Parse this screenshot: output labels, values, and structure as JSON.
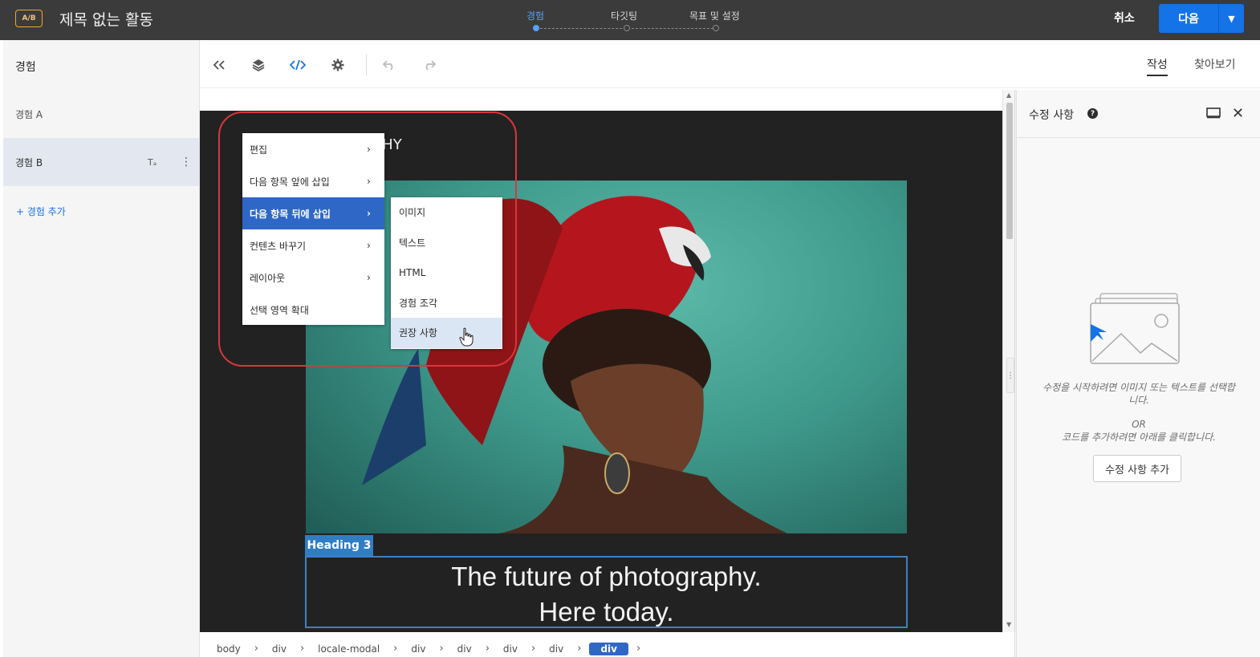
{
  "header": {
    "badge": "A/B",
    "title": "제목 없는 활동",
    "steps": [
      {
        "label": "경험",
        "active": true
      },
      {
        "label": "타깃팅",
        "active": false
      },
      {
        "label": "목표 및 설정",
        "active": false
      }
    ],
    "cancel_label": "취소",
    "next_label": "다음",
    "next_dropdown_icon": "chevron-down-icon"
  },
  "sidebar": {
    "heading": "경험",
    "items": [
      {
        "label": "경험 A",
        "selected": false
      },
      {
        "label": "경험 B",
        "selected": true
      }
    ],
    "rename_icon": "text-rename-icon",
    "more_icon": "more-vertical-icon",
    "add_label": "+ 경험 추가"
  },
  "toolbar": {
    "icons": [
      "collapse-left-icon",
      "layers-icon",
      "code-icon",
      "settings-icon",
      "undo-icon",
      "redo-icon"
    ],
    "tabs": [
      {
        "label": "작성",
        "active": true
      },
      {
        "label": "찾아보기",
        "active": false
      }
    ]
  },
  "canvas": {
    "partial_title": "APHY",
    "heading_tag": "Heading 3",
    "heading_line1": "The future of photography.",
    "heading_line2": "Here today."
  },
  "context_menu": {
    "items": [
      {
        "label": "편집",
        "has_submenu": true,
        "highlighted": false
      },
      {
        "label": "다음 항목 앞에 삽입",
        "has_submenu": true,
        "highlighted": false
      },
      {
        "label": "다음 항목 뒤에 삽입",
        "has_submenu": true,
        "highlighted": true
      },
      {
        "label": "컨텐츠 바꾸기",
        "has_submenu": true,
        "highlighted": false
      },
      {
        "label": "레이아웃",
        "has_submenu": true,
        "highlighted": false
      },
      {
        "label": "선택 영역 확대",
        "has_submenu": false,
        "highlighted": false
      }
    ],
    "submenu": [
      {
        "label": "이미지"
      },
      {
        "label": "텍스트"
      },
      {
        "label": "HTML"
      },
      {
        "label": "경험 조각"
      },
      {
        "label": "권장 사항",
        "hover": true
      }
    ]
  },
  "breadcrumb": [
    "body",
    "div",
    "locale-modal",
    "div",
    "div",
    "div",
    "div",
    "div"
  ],
  "panel": {
    "title": "수정 사항",
    "empty_text_1": "수정을 시작하려면 이미지 또는 텍스트를 선택합니다.",
    "empty_or": "OR",
    "empty_text_2": "코드를 추가하려면 아래를 클릭합니다.",
    "add_button": "수정 사항 추가"
  },
  "colors": {
    "accent": "#1473e6",
    "highlight": "#2f67c7",
    "outline": "#d8373c",
    "topbar": "#3b3b3b"
  }
}
